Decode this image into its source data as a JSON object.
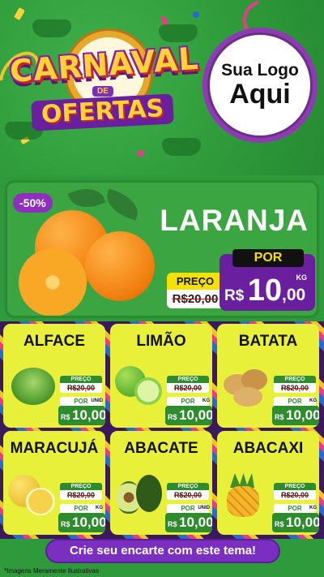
{
  "header": {
    "title_line1": "CARNAVAL",
    "title_connector": "DE",
    "title_line2": "OFERTAS",
    "logo_line1": "Sua Logo",
    "logo_line2": "Aqui"
  },
  "featured": {
    "discount": "-50%",
    "name": "LARANJA",
    "old_label": "PREÇO",
    "old_price": "R$20,00",
    "new_label": "POR",
    "unit": "KG",
    "currency": "R$",
    "price_int": "10",
    "price_dec": ",00"
  },
  "products": [
    {
      "name": "ALFACE",
      "preco_label": "PREÇO",
      "old_price": "R$20,00",
      "por_label": "POR",
      "unit": "UNID",
      "currency": "R$",
      "price": "10,00",
      "icon": "lettuce-icon"
    },
    {
      "name": "LIMÃO",
      "preco_label": "PREÇO",
      "old_price": "R$20,00",
      "por_label": "POR",
      "unit": "KG",
      "currency": "R$",
      "price": "10,00",
      "icon": "lime-icon"
    },
    {
      "name": "BATATA",
      "preco_label": "PREÇO",
      "old_price": "R$20,00",
      "por_label": "POR",
      "unit": "KG",
      "currency": "R$",
      "price": "10,00",
      "icon": "potato-icon"
    },
    {
      "name": "MARACUJÁ",
      "preco_label": "PREÇO",
      "old_price": "R$20,00",
      "por_label": "POR",
      "unit": "KG",
      "currency": "R$",
      "price": "10,00",
      "icon": "passion-fruit-icon"
    },
    {
      "name": "ABACATE",
      "preco_label": "PREÇO",
      "old_price": "R$20,00",
      "por_label": "POR",
      "unit": "UNID",
      "currency": "R$",
      "price": "10,00",
      "icon": "avocado-icon"
    },
    {
      "name": "ABACAXI",
      "preco_label": "PREÇO",
      "old_price": "R$20,00",
      "por_label": "POR",
      "unit": "KG",
      "currency": "R$",
      "price": "10,00",
      "icon": "pineapple-icon"
    }
  ],
  "cta": "Crie seu encarte com este tema!",
  "disclaimer": "*Imagens Meramente Ilustrativas",
  "colors": {
    "header_green": "#2f9a3b",
    "purple": "#7a2fc0",
    "yellow_card": "#e8f03a",
    "price_green": "#2e8b2e"
  }
}
